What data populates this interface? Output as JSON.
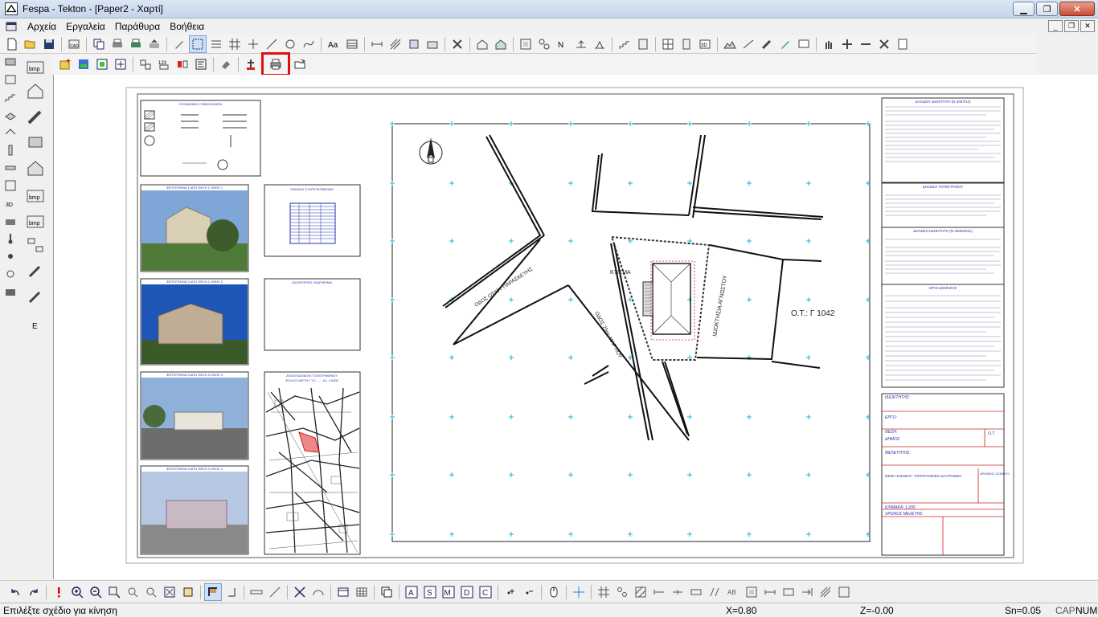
{
  "window": {
    "title": "Fespa - Tekton - [Paper2 - Χαρτί]"
  },
  "menu": {
    "items": [
      {
        "label": "Αρχεία"
      },
      {
        "label": "Εργαλεία"
      },
      {
        "label": "Παράθυρα"
      },
      {
        "label": "Βοήθεια"
      }
    ]
  },
  "drawing": {
    "legend_title": "ΥΠΟΜΝΗΜΑ ΣΥΜΒΟΛΙΣΜΩΝ",
    "photo_titles": [
      "ΦΩΤΟΓΡΑΦΙΑ 1 ΑΠΟ ΘΕΣΗ 1 ΟΨΗΣ 1",
      "ΦΩΤΟΓΡΑΦΙΑ 2 ΑΠΟ ΘΕΣΗ 2 ΟΨΗΣ 2",
      "ΦΩΤΟΓΡΑΦΙΑ 3 ΑΠΟ ΘΕΣΗ 3 ΟΨΗΣ 3",
      "ΦΩΤΟΓΡΑΦΙΑ 4 ΑΠΟ ΘΕΣΗ 4 ΟΨΗΣ 4"
    ],
    "coord_table_title": "ΠΙΝΑΚΑΣ ΣΥΝΤΕΤΑΓΜΕΝΩΝ",
    "location_title": "ΟΔΟΙΠΟΡΙΚΟ ΣΚΑΡΙΦΗΜΑ",
    "map_excerpt_title": "ΑΠΟΣΠΑΣΜΑ ΕΚ ΤΟΠΟΓΡΑΦΙΚΟΥ",
    "map_excerpt_subtitle": "ΦΥΛΛΟ ΧΑΡΤΗ Γ.Υ.Σ. ..... Κλ. 1:5000",
    "street1": "ΟΔΟΣ ΟΣΙΟΥ ΠΑΡΑΣΚΕΥΗΣ",
    "street2": "ΟΔΟΣ 25ης ΜΑΡΤΙΟΥ",
    "street3": "ΙΔΙΟΚΤΗΣΙΑ ΑΓΝΩΣΤΟΥ",
    "building_label": "ΚΤΙΣΜΑ",
    "block_label": "Ο.Τ.: Γ 1042",
    "notes_title_1": "ΔΗΛΩΣΗ ΙΔΙΟΚΤΗΤΗ (Ν.4067/12)",
    "notes_title_2": "ΔΗΛΩΣΗ ΤΟΠΟΓΡΑΦΟΥ",
    "notes_title_3": "ΔΗΛΩΣΗ ΙΔΙΟΚΤΗΤΗ (Ν.4030/2011)",
    "notes_title_4": "ΟΡΟΙ ΔΟΜΗΣΗΣ",
    "tb_owner": "ΙΔΙΟΚΤΗΤΗΣ:",
    "tb_project": "ΕΡΓΟ:",
    "tb_location": "ΘΕΣΗ:",
    "tb_municipality": "ΔΗΜΟΣ:",
    "tb_block": "Ο.Τ.",
    "tb_engineer": "ΜΕΛΕΤΗΤΗΣ:",
    "tb_subject": "ΘΕΜΑ ΣΧΕΔΙΟΥ: ΤΟΠΟΓΡΑΦΙΚΟ ΔΙΑΓΡΑΜΜΑ",
    "tb_drawing_no": "ΑΡΙΘΜΟΣ ΣΧΕΔΙΟΥ",
    "tb_scale": "ΚΛΙΜΑΚΑ: 1:200",
    "tb_date": "ΧΡΟΝΟΣ ΜΕΛΕΤΗΣ:"
  },
  "status": {
    "message": "Επιλέξτε σχέδιο για κίνηση",
    "x": "X=0.80",
    "z": "Z=-0.00",
    "snap": "Sn=0.05",
    "caps": "CAP",
    "num": "NUM"
  },
  "bottom_toolbar_letters": [
    "A",
    "S",
    "M",
    "D",
    "C"
  ],
  "colors": {
    "titlebar": "#c4d5ec",
    "highlight": "#e01010",
    "grid_cross": "#19b8d8",
    "drawing_blue": "#2233aa",
    "drawing_red": "#cc2222"
  }
}
